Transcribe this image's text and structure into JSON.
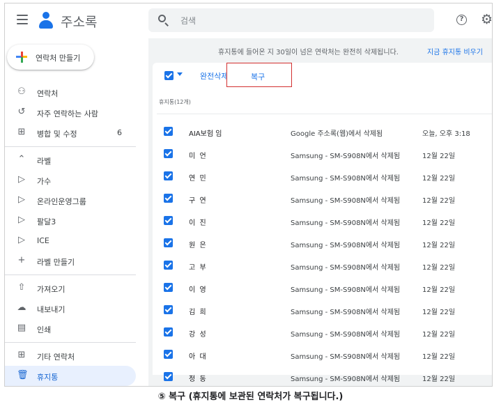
{
  "header": {
    "app_title": "주소록",
    "search_placeholder": "검색",
    "icons": [
      "menu-icon",
      "contacts-logo-icon",
      "search-icon",
      "help-icon",
      "gear-icon"
    ]
  },
  "sidebar": {
    "create_label": "연락처 만들기",
    "items": [
      {
        "label": "연락처",
        "icon": "person-icon"
      },
      {
        "label": "자주 연락하는 사람",
        "icon": "history-icon"
      },
      {
        "label": "병합 및 수정",
        "icon": "merge-icon",
        "count": "6"
      },
      {
        "label": "라벨",
        "icon": "chevron-up-icon"
      },
      {
        "label": "가수",
        "icon": "label-icon"
      },
      {
        "label": "온라인운영그룹",
        "icon": "label-icon"
      },
      {
        "label": "팔달3",
        "icon": "label-icon"
      },
      {
        "label": "ICE",
        "icon": "label-icon"
      },
      {
        "label": "라벨 만들기",
        "icon": "plus-icon"
      },
      {
        "label": "가져오기",
        "icon": "upload-icon"
      },
      {
        "label": "내보내기",
        "icon": "cloud-download-icon"
      },
      {
        "label": "인쇄",
        "icon": "print-icon"
      },
      {
        "label": "기타 연락처",
        "icon": "add-box-icon"
      },
      {
        "label": "휴지통",
        "icon": "trash-icon"
      }
    ]
  },
  "main": {
    "banner_text": "휴지통에 들어온 지 30일이 넘은 연락처는 완전히 삭제됩니다.",
    "banner_link": "지금 휴지통 비우기",
    "delete_label": "완전삭제",
    "restore_label": "복구",
    "section_label": "휴지통(12개)",
    "rows": [
      {
        "name": "AIA보험 임",
        "source": "Google 주소록(웹)에서 삭제됨",
        "date": "오늘, 오후 3:18"
      },
      {
        "name": "미  언",
        "source": "Samsung - SM-S908N에서 삭제됨",
        "date": "12월 22일"
      },
      {
        "name": "연  민",
        "source": "Samsung - SM-S908N에서 삭제됨",
        "date": "12월 22일"
      },
      {
        "name": "구  연",
        "source": "Samsung - SM-S908N에서 삭제됨",
        "date": "12월 22일"
      },
      {
        "name": "이  진",
        "source": "Samsung - SM-S908N에서 삭제됨",
        "date": "12월 22일"
      },
      {
        "name": "원  은",
        "source": "Samsung - SM-S908N에서 삭제됨",
        "date": "12월 22일"
      },
      {
        "name": "고  부",
        "source": "Samsung - SM-S908N에서 삭제됨",
        "date": "12월 22일"
      },
      {
        "name": "이  영",
        "source": "Samsung - SM-S908N에서 삭제됨",
        "date": "12월 22일"
      },
      {
        "name": "김  희",
        "source": "Samsung - SM-S908N에서 삭제됨",
        "date": "12월 22일"
      },
      {
        "name": "강  성",
        "source": "Samsung - SM-S908N에서 삭제됨",
        "date": "12월 22일"
      },
      {
        "name": "아  대",
        "source": "Samsung - SM-S908N에서 삭제됨",
        "date": "12월 22일"
      },
      {
        "name": "정  동",
        "source": "Samsung - SM-S908N에서 삭제됨",
        "date": "12월 22일"
      }
    ]
  },
  "caption": "⑤ 복구 (휴지통에 보관된 연락처가 복구됩니다.)",
  "colors": {
    "accent": "#1a73e8",
    "highlight_box": "#d32f2f",
    "active_nav_bg": "#e8f0fe"
  }
}
